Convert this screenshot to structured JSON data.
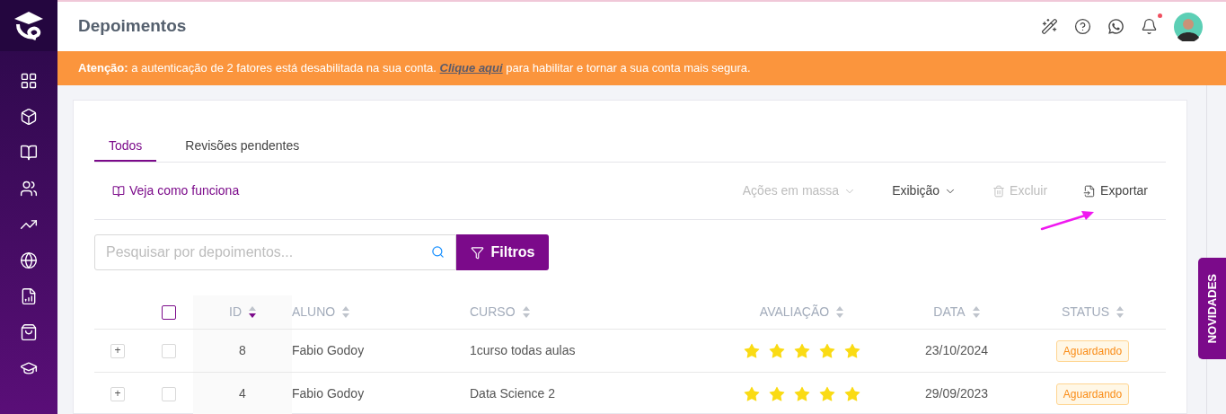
{
  "page_title": "Depoimentos",
  "notifications": {
    "unread": true
  },
  "alert": {
    "text": "**Atenção:** a autenticação de 2 fatores está desabilitada na sua conta.",
    "link": "Clique aqui",
    "text_after": "para habilitar e tornar a sua conta mais segura."
  },
  "tabs": [
    {
      "label": "Todos",
      "selected": true
    },
    {
      "label": "Revisões pendentes",
      "selected": false
    }
  ],
  "help_link": "Veja como funciona",
  "actions": [
    {
      "label": "Ações em massa",
      "kind": "dropdown",
      "disabled": true
    },
    {
      "label": "Exibição",
      "kind": "dropdown",
      "disabled": false
    },
    {
      "label": "Excluir",
      "kind": "delete",
      "disabled": true
    },
    {
      "label": "Exportar",
      "kind": "export",
      "disabled": false
    }
  ],
  "search": {
    "placeholder": "Pesquisar por depoimentos..."
  },
  "filter_button": "Filtros",
  "table": {
    "select_all_checked": false,
    "columns": [
      {
        "label": "ID",
        "sorted_descending": true
      },
      {
        "label": "ALUNO",
        "sorted_descending": false
      },
      {
        "label": "CURSO",
        "sorted_descending": false
      },
      {
        "label": "AVALIAÇÃO",
        "sorted_descending": false
      },
      {
        "label": "DATA",
        "sorted_descending": false
      },
      {
        "label": "STATUS",
        "sorted_descending": false
      }
    ],
    "rows": [
      {
        "expand": "+",
        "checked": false,
        "id": "8",
        "aluno": "Fabio Godoy",
        "curso": "1curso todas aulas",
        "stars": 5,
        "data": "23/10/2024",
        "status": "Aguardando"
      },
      {
        "expand": "+",
        "checked": false,
        "id": "4",
        "aluno": "Fabio Godoy",
        "curso": "Data Science 2",
        "stars": 5,
        "data": "29/09/2023",
        "status": "Aguardando"
      }
    ]
  },
  "side_tab": "NOVIDADES"
}
